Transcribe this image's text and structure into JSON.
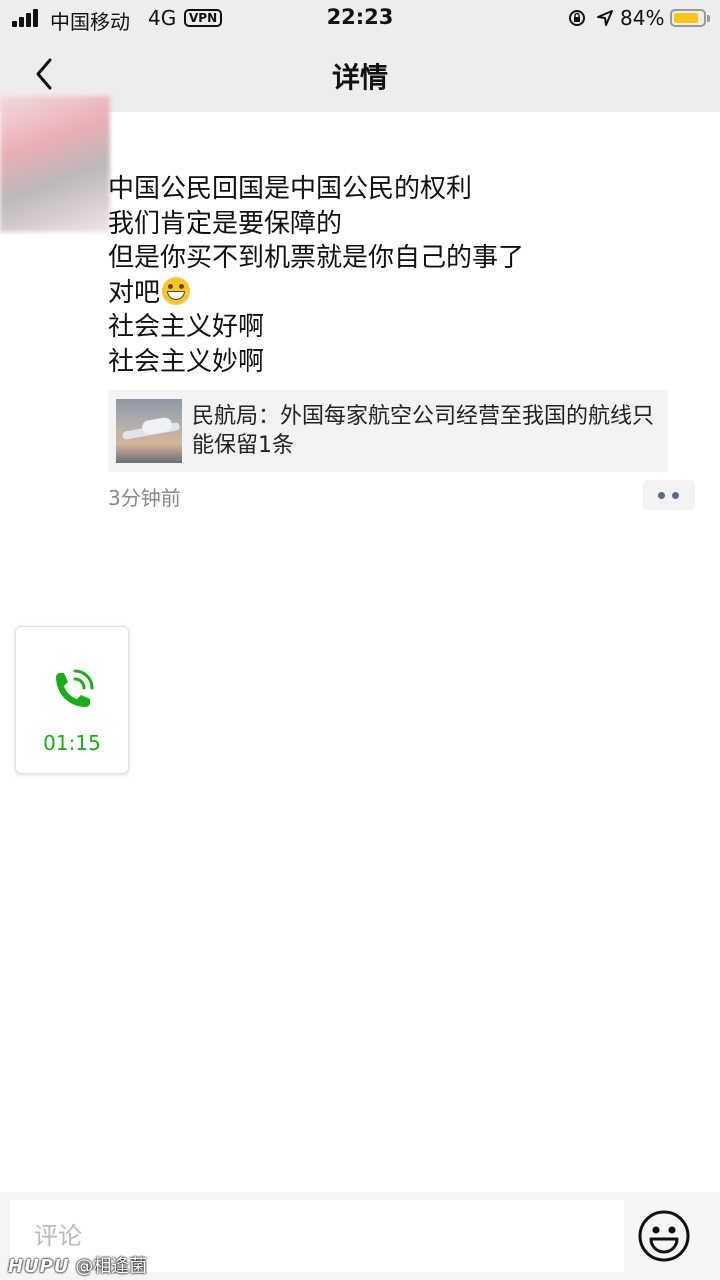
{
  "status_bar": {
    "carrier": "中国移动",
    "network": "4G",
    "vpn": "VPN",
    "time": "22:23",
    "battery_percent": "84%",
    "battery_level": 0.84
  },
  "nav": {
    "title": "详情"
  },
  "post": {
    "lines": [
      "中国公民回国是中国公民的权利",
      "我们肯定是要保障的",
      "但是你买不到机票就是你自己的事了",
      "对吧",
      "社会主义好啊",
      "社会主义妙啊"
    ],
    "link_title": "民航局：外国每家航空公司经营至我国的航线只能保留1条",
    "time": "3分钟前"
  },
  "call_widget": {
    "duration": "01:15",
    "color": "#1aad19"
  },
  "comment": {
    "placeholder": "评论"
  },
  "watermark": {
    "brand": "HUPU",
    "handle": "@相逢菌"
  }
}
